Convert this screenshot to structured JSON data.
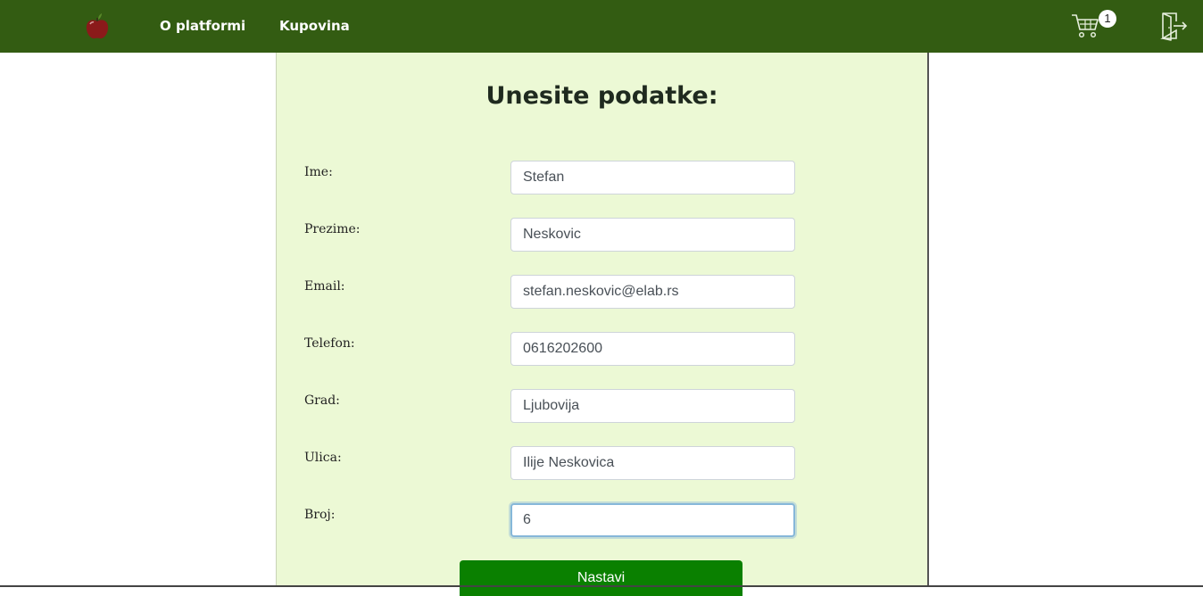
{
  "nav": {
    "logo_icon": "apple-icon",
    "links": [
      {
        "label": "O platformi"
      },
      {
        "label": "Kupovina"
      }
    ],
    "cart": {
      "icon": "cart-icon",
      "count": "1"
    },
    "logout": {
      "icon": "logout-door-icon"
    },
    "colors": {
      "bar": "#335c12",
      "text": "#ffffff"
    }
  },
  "form": {
    "title": "Unesite podatke:",
    "fields": [
      {
        "label": "Ime:",
        "value": "Stefan"
      },
      {
        "label": "Prezime:",
        "value": "Neskovic"
      },
      {
        "label": "Email:",
        "value": "stefan.neskovic@elab.rs"
      },
      {
        "label": "Telefon:",
        "value": "0616202600"
      },
      {
        "label": "Grad:",
        "value": "Ljubovija"
      },
      {
        "label": "Ulica:",
        "value": "Ilije Neskovica"
      },
      {
        "label": "Broj:",
        "value": "6"
      }
    ],
    "submit_label": "Nastavi",
    "colors": {
      "panel": "#ecf9d5",
      "submit": "#0a8000"
    }
  }
}
